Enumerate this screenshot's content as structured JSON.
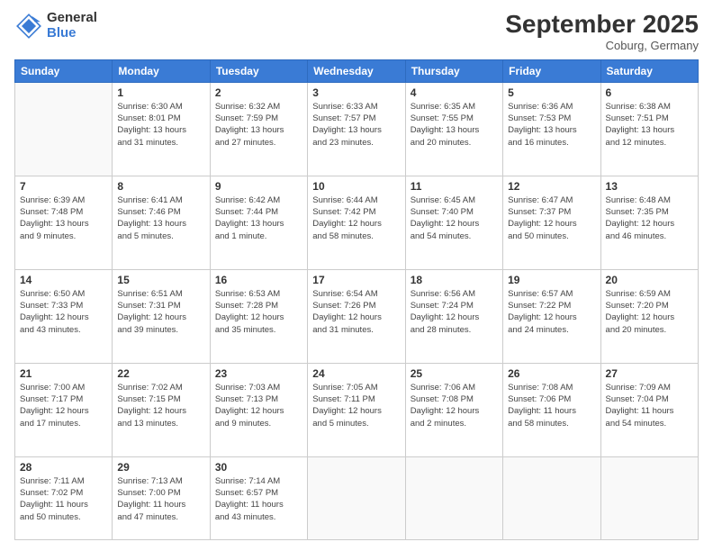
{
  "logo": {
    "general": "General",
    "blue": "Blue"
  },
  "title": "September 2025",
  "subtitle": "Coburg, Germany",
  "weekdays": [
    "Sunday",
    "Monday",
    "Tuesday",
    "Wednesday",
    "Thursday",
    "Friday",
    "Saturday"
  ],
  "weeks": [
    [
      {
        "day": "",
        "info": ""
      },
      {
        "day": "1",
        "info": "Sunrise: 6:30 AM\nSunset: 8:01 PM\nDaylight: 13 hours\nand 31 minutes."
      },
      {
        "day": "2",
        "info": "Sunrise: 6:32 AM\nSunset: 7:59 PM\nDaylight: 13 hours\nand 27 minutes."
      },
      {
        "day": "3",
        "info": "Sunrise: 6:33 AM\nSunset: 7:57 PM\nDaylight: 13 hours\nand 23 minutes."
      },
      {
        "day": "4",
        "info": "Sunrise: 6:35 AM\nSunset: 7:55 PM\nDaylight: 13 hours\nand 20 minutes."
      },
      {
        "day": "5",
        "info": "Sunrise: 6:36 AM\nSunset: 7:53 PM\nDaylight: 13 hours\nand 16 minutes."
      },
      {
        "day": "6",
        "info": "Sunrise: 6:38 AM\nSunset: 7:51 PM\nDaylight: 13 hours\nand 12 minutes."
      }
    ],
    [
      {
        "day": "7",
        "info": "Sunrise: 6:39 AM\nSunset: 7:48 PM\nDaylight: 13 hours\nand 9 minutes."
      },
      {
        "day": "8",
        "info": "Sunrise: 6:41 AM\nSunset: 7:46 PM\nDaylight: 13 hours\nand 5 minutes."
      },
      {
        "day": "9",
        "info": "Sunrise: 6:42 AM\nSunset: 7:44 PM\nDaylight: 13 hours\nand 1 minute."
      },
      {
        "day": "10",
        "info": "Sunrise: 6:44 AM\nSunset: 7:42 PM\nDaylight: 12 hours\nand 58 minutes."
      },
      {
        "day": "11",
        "info": "Sunrise: 6:45 AM\nSunset: 7:40 PM\nDaylight: 12 hours\nand 54 minutes."
      },
      {
        "day": "12",
        "info": "Sunrise: 6:47 AM\nSunset: 7:37 PM\nDaylight: 12 hours\nand 50 minutes."
      },
      {
        "day": "13",
        "info": "Sunrise: 6:48 AM\nSunset: 7:35 PM\nDaylight: 12 hours\nand 46 minutes."
      }
    ],
    [
      {
        "day": "14",
        "info": "Sunrise: 6:50 AM\nSunset: 7:33 PM\nDaylight: 12 hours\nand 43 minutes."
      },
      {
        "day": "15",
        "info": "Sunrise: 6:51 AM\nSunset: 7:31 PM\nDaylight: 12 hours\nand 39 minutes."
      },
      {
        "day": "16",
        "info": "Sunrise: 6:53 AM\nSunset: 7:28 PM\nDaylight: 12 hours\nand 35 minutes."
      },
      {
        "day": "17",
        "info": "Sunrise: 6:54 AM\nSunset: 7:26 PM\nDaylight: 12 hours\nand 31 minutes."
      },
      {
        "day": "18",
        "info": "Sunrise: 6:56 AM\nSunset: 7:24 PM\nDaylight: 12 hours\nand 28 minutes."
      },
      {
        "day": "19",
        "info": "Sunrise: 6:57 AM\nSunset: 7:22 PM\nDaylight: 12 hours\nand 24 minutes."
      },
      {
        "day": "20",
        "info": "Sunrise: 6:59 AM\nSunset: 7:20 PM\nDaylight: 12 hours\nand 20 minutes."
      }
    ],
    [
      {
        "day": "21",
        "info": "Sunrise: 7:00 AM\nSunset: 7:17 PM\nDaylight: 12 hours\nand 17 minutes."
      },
      {
        "day": "22",
        "info": "Sunrise: 7:02 AM\nSunset: 7:15 PM\nDaylight: 12 hours\nand 13 minutes."
      },
      {
        "day": "23",
        "info": "Sunrise: 7:03 AM\nSunset: 7:13 PM\nDaylight: 12 hours\nand 9 minutes."
      },
      {
        "day": "24",
        "info": "Sunrise: 7:05 AM\nSunset: 7:11 PM\nDaylight: 12 hours\nand 5 minutes."
      },
      {
        "day": "25",
        "info": "Sunrise: 7:06 AM\nSunset: 7:08 PM\nDaylight: 12 hours\nand 2 minutes."
      },
      {
        "day": "26",
        "info": "Sunrise: 7:08 AM\nSunset: 7:06 PM\nDaylight: 11 hours\nand 58 minutes."
      },
      {
        "day": "27",
        "info": "Sunrise: 7:09 AM\nSunset: 7:04 PM\nDaylight: 11 hours\nand 54 minutes."
      }
    ],
    [
      {
        "day": "28",
        "info": "Sunrise: 7:11 AM\nSunset: 7:02 PM\nDaylight: 11 hours\nand 50 minutes."
      },
      {
        "day": "29",
        "info": "Sunrise: 7:13 AM\nSunset: 7:00 PM\nDaylight: 11 hours\nand 47 minutes."
      },
      {
        "day": "30",
        "info": "Sunrise: 7:14 AM\nSunset: 6:57 PM\nDaylight: 11 hours\nand 43 minutes."
      },
      {
        "day": "",
        "info": ""
      },
      {
        "day": "",
        "info": ""
      },
      {
        "day": "",
        "info": ""
      },
      {
        "day": "",
        "info": ""
      }
    ]
  ]
}
